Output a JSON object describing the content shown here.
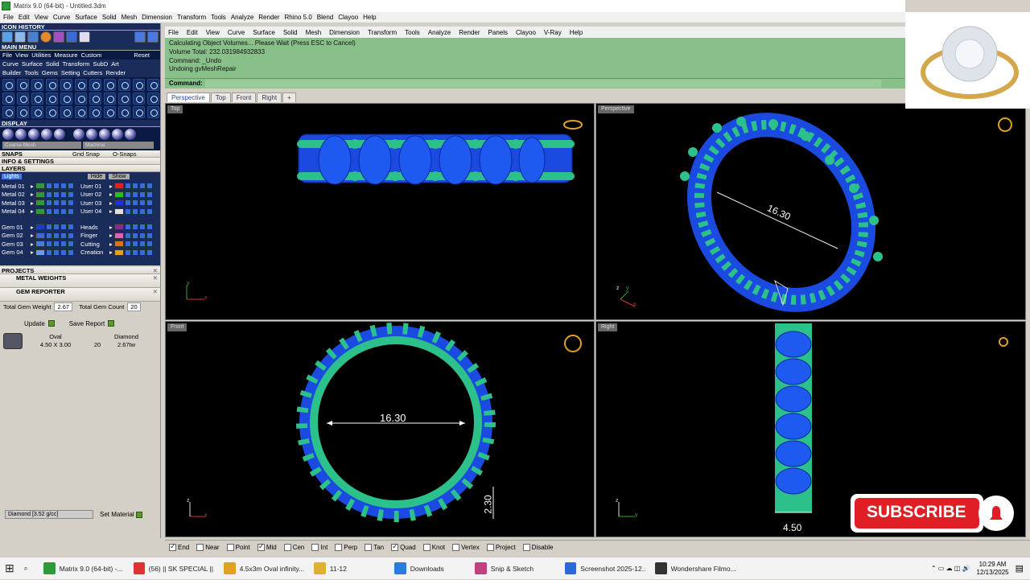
{
  "window": {
    "title": "Matrix 9.0 (64-bit) - Untitled.3dm"
  },
  "main_menu": [
    "File",
    "Edit",
    "View",
    "Curve",
    "Surface",
    "Solid",
    "Mesh",
    "Dimension",
    "Transform",
    "Tools",
    "Analyze",
    "Render",
    "Rhino 5.0",
    "Blend",
    "Clayoo",
    "Help"
  ],
  "rhino_menu": [
    "File",
    "Edit",
    "View",
    "Curve",
    "Surface",
    "Solid",
    "Mesh",
    "Dimension",
    "Transform",
    "Tools",
    "Analyze",
    "Render",
    "Panels",
    "Clayoo",
    "V-Ray",
    "Help"
  ],
  "command_history": [
    "Calculating Object Volumes... Please Wait (Press ESC to Cancel)",
    "Volume Total: 232.031984932833",
    "Command: _Undo",
    "Undoing gvMeshRepair"
  ],
  "command_prompt": "Command:",
  "viewport_tabs": [
    "Perspective",
    "Top",
    "Front",
    "Right"
  ],
  "left_panel": {
    "icon_history": "ICON HISTORY",
    "main_menu": "MAIN MENU",
    "menu_items": [
      "File",
      "View",
      "Utilities",
      "Measure",
      "Custom",
      "Reset"
    ],
    "ribbon1": [
      "Curve",
      "Surface",
      "Solid",
      "Transform",
      "SubD",
      "Art"
    ],
    "ribbon2": [
      "Builder",
      "Tools",
      "Gems",
      "Setting",
      "Cutters",
      "Render"
    ],
    "display": "DISPLAY",
    "display_mode": "Coarse Mesh",
    "display_mode2": "Machine",
    "snaps": "SNAPS",
    "grid_snap": "Grid Snap",
    "o_snaps": "O-Snaps",
    "info_settings": "INFO & SETTINGS",
    "layers": "LAYERS",
    "lights": "Lights",
    "hide": "Hide",
    "show": "Show",
    "layers_left": [
      {
        "name": "Metal 01",
        "color": "#2e9a3a"
      },
      {
        "name": "Metal 02",
        "color": "#2e9a3a"
      },
      {
        "name": "Metal 03",
        "color": "#2e9a3a"
      },
      {
        "name": "Metal 04",
        "color": "#2e9a3a"
      },
      {
        "name": "Gem 01",
        "color": "#1a3ad8"
      },
      {
        "name": "Gem 02",
        "color": "#3a6ad8"
      },
      {
        "name": "Gem 03",
        "color": "#4a7ae0"
      },
      {
        "name": "Gem 04",
        "color": "#6a9ae8"
      }
    ],
    "layers_right": [
      {
        "name": "User 01",
        "color": "#e02020"
      },
      {
        "name": "User 02",
        "color": "#20c020"
      },
      {
        "name": "User 03",
        "color": "#2030e0"
      },
      {
        "name": "User 04",
        "color": "#e0e0e0"
      },
      {
        "name": "Heads",
        "color": "#8a2a8a"
      },
      {
        "name": "Finger",
        "color": "#e060c0"
      },
      {
        "name": "Cutting",
        "color": "#e07020"
      },
      {
        "name": "Creation",
        "color": "#e0a020"
      }
    ],
    "projects": "PROJECTS",
    "metal_weights": "METAL WEIGHTS",
    "gem_reporter": "GEM REPORTER",
    "total_gem_weight_label": "Total Gem Weight",
    "total_gem_weight": "2.67",
    "total_gem_count_label": "Total Gem Count",
    "total_gem_count": "20",
    "update": "Update",
    "save_report": "Save Report",
    "gem_shape": "Oval",
    "gem_type": "Diamond",
    "gem_size": "4.50 X 3.00",
    "gem_count": "20",
    "gem_tw": "2.67tw",
    "material": "Diamond  [3.52 g/cc]",
    "set_material": "Set Material"
  },
  "viewports": {
    "top": {
      "label": "Top",
      "axis_y": "y",
      "axis_x": "x"
    },
    "perspective": {
      "label": "Perspective",
      "dimension": "16.30",
      "axis_z": "z",
      "axis_y": "y",
      "axis_x": "x"
    },
    "front": {
      "label": "Front",
      "dimension": "16.30",
      "dimension2": "2.30",
      "axis_z": "z",
      "axis_x": "x"
    },
    "right": {
      "label": "Right",
      "dimension": "4.50",
      "axis_z": "z",
      "axis_y": "y"
    }
  },
  "osnaps": [
    {
      "label": "End",
      "on": true
    },
    {
      "label": "Near",
      "on": false
    },
    {
      "label": "Point",
      "on": false
    },
    {
      "label": "Mid",
      "on": true
    },
    {
      "label": "Cen",
      "on": false
    },
    {
      "label": "Int",
      "on": false
    },
    {
      "label": "Perp",
      "on": false
    },
    {
      "label": "Tan",
      "on": false
    },
    {
      "label": "Quad",
      "on": true
    },
    {
      "label": "Knot",
      "on": false
    },
    {
      "label": "Vertex",
      "on": false
    },
    {
      "label": "Project",
      "on": false
    },
    {
      "label": "Disable",
      "on": false
    }
  ],
  "subscribe": "SUBSCRIBE",
  "taskbar": {
    "items": [
      "Matrix 9.0 (64-bit) -...",
      "(56) || SK SPECIAL ||...",
      "4.5x3m Oval infinity...",
      "11-12",
      "Downloads",
      "Snip & Sketch",
      "Screenshot 2025-12...",
      "Wondershare Filmo..."
    ],
    "time": "10:29 AM",
    "date": "12/13/2025"
  },
  "colors": {
    "metal": "#2bb07a",
    "gem": "#1a4ae0",
    "cmd_bg": "#89c08a"
  }
}
